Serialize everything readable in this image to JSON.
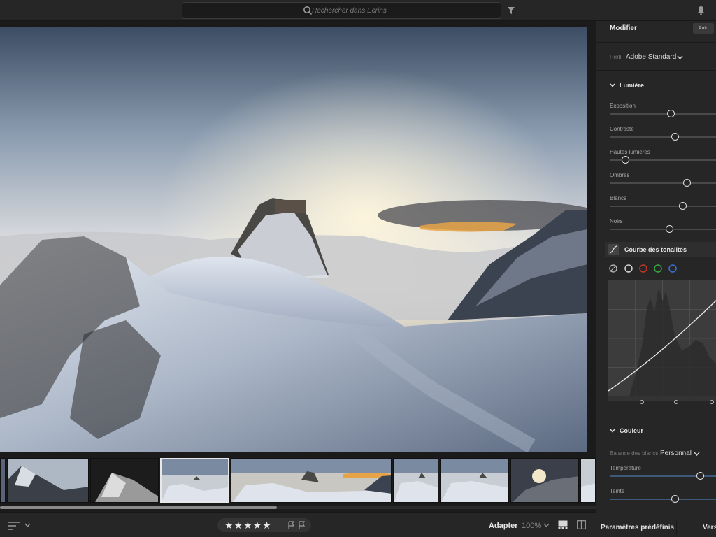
{
  "topbar": {
    "search_placeholder": "Rechercher dans Ecrins",
    "icons": [
      "search-icon",
      "filter-icon",
      "bell-icon"
    ]
  },
  "edit_panel": {
    "title": "Modifier",
    "auto_label": "Auto",
    "profile_label": "Profil",
    "profile_value": "Adobe Standard",
    "light_section": "Lumière",
    "sliders": [
      {
        "label": "Exposition",
        "value": 0.58
      },
      {
        "label": "Contraste",
        "value": 0.62
      },
      {
        "label": "Hautes lumières",
        "value": 0.12
      },
      {
        "label": "Ombres",
        "value": 0.74
      },
      {
        "label": "Blancs",
        "value": 0.7
      },
      {
        "label": "Noirs",
        "value": 0.56
      }
    ],
    "curve_title": "Courbe des tonalités",
    "channel_colors": [
      "#d0d0d0",
      "#c0392b",
      "#3aa845",
      "#3a6fd8"
    ],
    "color_section": "Couleur",
    "wb_label": "Balance des blancs",
    "wb_value": "Personnal",
    "color_sliders": [
      {
        "label": "Température",
        "value": 0.87
      },
      {
        "label": "Teinte",
        "value": 0.62
      }
    ]
  },
  "bottombar": {
    "stars": "★★★★★",
    "fit_label": "Adapter",
    "zoom_label": "100%",
    "presets_label": "Paramètres prédéfinis",
    "versions_label": "Versi"
  }
}
